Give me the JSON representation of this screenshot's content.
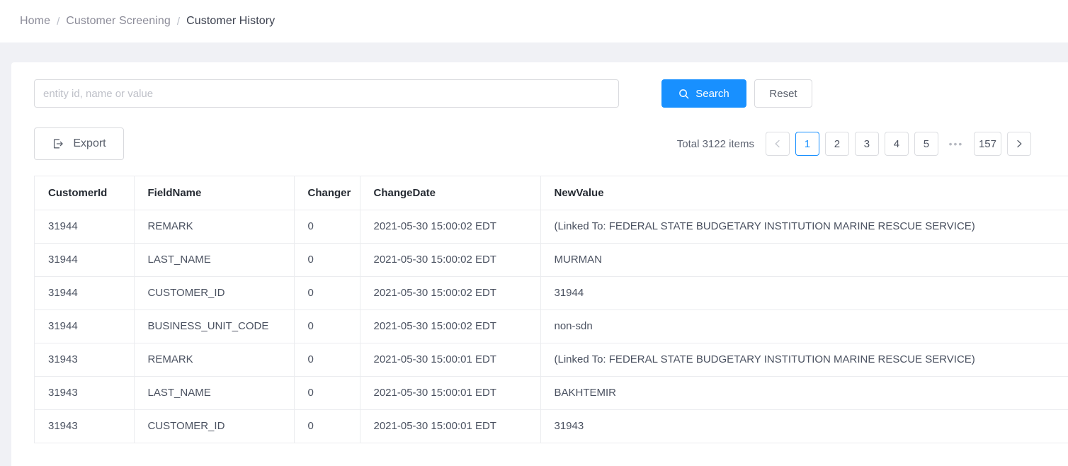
{
  "breadcrumb": {
    "separator": "/",
    "items": [
      {
        "label": "Home",
        "current": false
      },
      {
        "label": "Customer Screening",
        "current": false
      },
      {
        "label": "Customer History",
        "current": true
      }
    ]
  },
  "search": {
    "placeholder": "entity id, name or value",
    "value": "",
    "search_label": "Search",
    "reset_label": "Reset",
    "search_icon": "search-icon",
    "accent_color": "#1890ff"
  },
  "toolbar": {
    "export_label": "Export",
    "export_icon": "export-icon"
  },
  "pagination": {
    "total_text": "Total 3122 items",
    "prev_label": "‹",
    "next_label": "›",
    "ellipsis": "•••",
    "pages": [
      "1",
      "2",
      "3",
      "4",
      "5"
    ],
    "last_page": "157",
    "active_page": "1",
    "active_color": "#1890ff"
  },
  "table": {
    "columns": [
      "CustomerId",
      "FieldName",
      "Changer",
      "ChangeDate",
      "NewValue"
    ],
    "rows": [
      {
        "customer_id": "31944",
        "field_name": "REMARK",
        "changer": "0",
        "change_date": "2021-05-30 15:00:02 EDT",
        "new_value": "(Linked To: FEDERAL STATE BUDGETARY INSTITUTION MARINE RESCUE SERVICE)"
      },
      {
        "customer_id": "31944",
        "field_name": "LAST_NAME",
        "changer": "0",
        "change_date": "2021-05-30 15:00:02 EDT",
        "new_value": "MURMAN"
      },
      {
        "customer_id": "31944",
        "field_name": "CUSTOMER_ID",
        "changer": "0",
        "change_date": "2021-05-30 15:00:02 EDT",
        "new_value": "31944"
      },
      {
        "customer_id": "31944",
        "field_name": "BUSINESS_UNIT_CODE",
        "changer": "0",
        "change_date": "2021-05-30 15:00:02 EDT",
        "new_value": "non-sdn"
      },
      {
        "customer_id": "31943",
        "field_name": "REMARK",
        "changer": "0",
        "change_date": "2021-05-30 15:00:01 EDT",
        "new_value": "(Linked To: FEDERAL STATE BUDGETARY INSTITUTION MARINE RESCUE SERVICE)"
      },
      {
        "customer_id": "31943",
        "field_name": "LAST_NAME",
        "changer": "0",
        "change_date": "2021-05-30 15:00:01 EDT",
        "new_value": "BAKHTEMIR"
      },
      {
        "customer_id": "31943",
        "field_name": "CUSTOMER_ID",
        "changer": "0",
        "change_date": "2021-05-30 15:00:01 EDT",
        "new_value": "31943"
      }
    ]
  }
}
